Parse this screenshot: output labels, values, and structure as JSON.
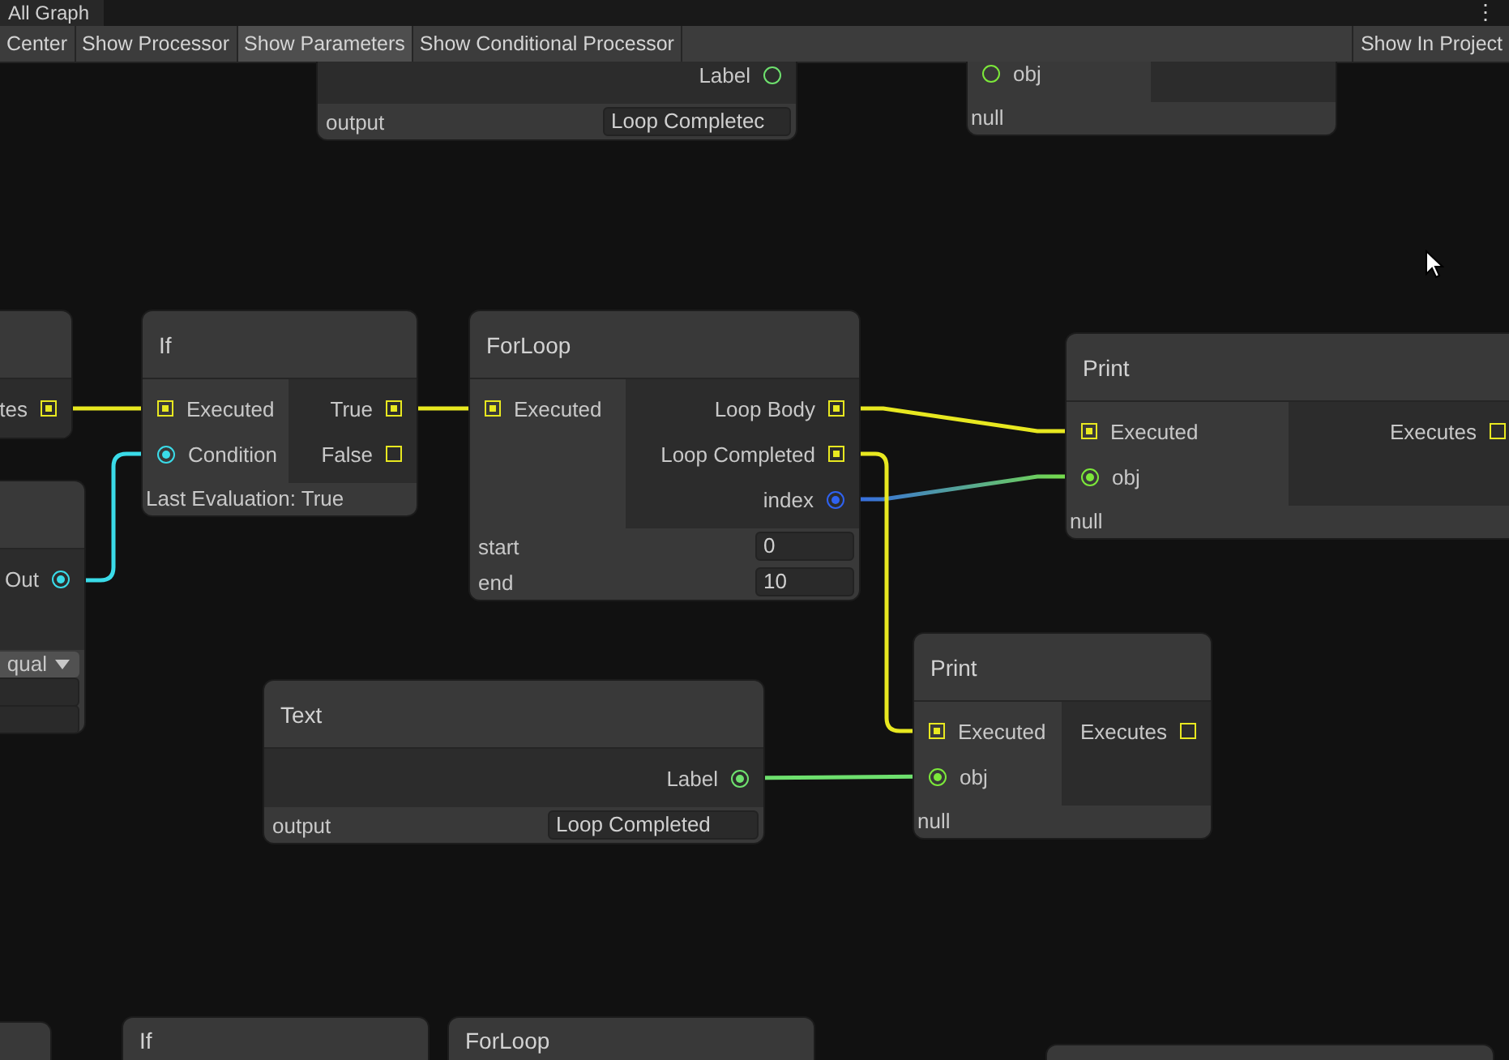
{
  "window": {
    "title": "All Graph",
    "menu_icon": "⋮"
  },
  "toolbar": {
    "left": [
      {
        "label": "Center",
        "selected": false
      },
      {
        "label": "Show Processor",
        "selected": false
      },
      {
        "label": "Show Parameters",
        "selected": true
      },
      {
        "label": "Show Conditional Processor",
        "selected": false
      }
    ],
    "right": [
      {
        "label": "Show In Project",
        "selected": false
      }
    ]
  },
  "nodes": [
    {
      "outputs": [
        {
          "label": "Label",
          "kind": "value",
          "color": "#6ee06e",
          "connected": false
        }
      ],
      "fields": [
        {
          "kind": "input",
          "label": "output",
          "value": "Loop Completec"
        }
      ]
    },
    {
      "inputs": [
        {
          "label": "obj",
          "kind": "value",
          "color": "#7ce83a",
          "connected": false
        }
      ],
      "footer": "null"
    },
    {
      "outputs": [
        {
          "label": "tes",
          "kind": "exec",
          "color": "#e8e820",
          "connected": true
        }
      ]
    },
    {
      "title": "If",
      "inputs": [
        {
          "label": "Executed",
          "kind": "exec",
          "color": "#e8e820",
          "connected": true
        },
        {
          "label": "Condition",
          "kind": "value",
          "color": "#3adbe8",
          "connected": true
        }
      ],
      "outputs": [
        {
          "label": "True",
          "kind": "exec",
          "color": "#e8e820",
          "connected": true
        },
        {
          "label": "False",
          "kind": "exec",
          "color": "#e8e820",
          "connected": false
        }
      ],
      "footer": "Last Evaluation: True"
    },
    {
      "title": "ForLoop",
      "inputs": [
        {
          "label": "Executed",
          "kind": "exec",
          "color": "#e8e820",
          "connected": true
        }
      ],
      "outputs": [
        {
          "label": "Loop Body",
          "kind": "exec",
          "color": "#e8e820",
          "connected": true
        },
        {
          "label": "Loop Completed",
          "kind": "exec",
          "color": "#e8e820",
          "connected": true
        },
        {
          "label": "index",
          "kind": "value",
          "color": "#2f62f0",
          "connected": true
        }
      ],
      "fields": [
        {
          "kind": "input",
          "label": "start",
          "value": "0"
        },
        {
          "kind": "input",
          "label": "end",
          "value": "10"
        }
      ]
    },
    {
      "title": "Print",
      "inputs": [
        {
          "label": "Executed",
          "kind": "exec",
          "color": "#e8e820",
          "connected": true
        },
        {
          "label": "obj",
          "kind": "value",
          "color": "#7ce83a",
          "connected": true
        }
      ],
      "outputs": [
        {
          "label": "Executes",
          "kind": "exec",
          "color": "#e8e820",
          "connected": false
        }
      ],
      "footer": "null"
    },
    {
      "outputs": [
        {
          "label": "Out",
          "kind": "value",
          "color": "#3adbe8",
          "connected": true
        }
      ],
      "fields": [
        {
          "kind": "dropdown",
          "value": "qual"
        },
        {
          "kind": "input"
        },
        {
          "kind": "input"
        }
      ]
    },
    {
      "title": "Text",
      "outputs": [
        {
          "label": "Label",
          "kind": "value",
          "color": "#6ee06e",
          "connected": true
        }
      ],
      "fields": [
        {
          "kind": "input",
          "label": "output",
          "value": "Loop Completed"
        }
      ]
    },
    {
      "title": "Print",
      "inputs": [
        {
          "label": "Executed",
          "kind": "exec",
          "color": "#e8e820",
          "connected": true
        },
        {
          "label": "obj",
          "kind": "value",
          "color": "#7ce83a",
          "connected": true
        }
      ],
      "outputs": [
        {
          "label": "Executes",
          "kind": "exec",
          "color": "#e8e820",
          "connected": false
        }
      ],
      "footer": "null"
    },
    {
      "title": "If"
    },
    {
      "title": "ForLoop"
    }
  ]
}
